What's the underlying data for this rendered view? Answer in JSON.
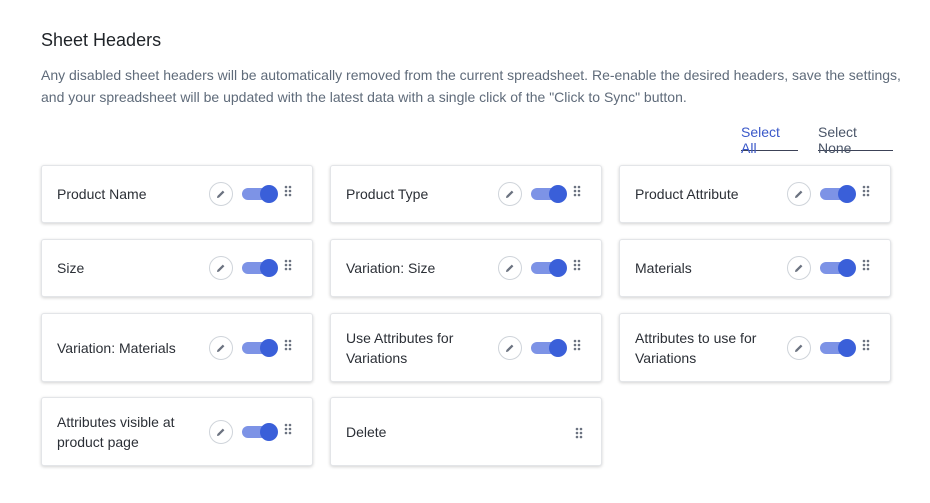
{
  "section": {
    "title": "Sheet Headers",
    "description": "Any disabled sheet headers will be automatically removed from the current spreadsheet. Re-enable the desired headers, save the settings, and your spreadsheet will be updated with the latest data with a single click of the \"Click to Sync\" button."
  },
  "actions": {
    "select_all": "Select All",
    "select_none": "Select None"
  },
  "colors": {
    "accent": "#3a5fd9",
    "toggle_track": "#7d93e6",
    "link": "#3a58c9"
  },
  "headers": [
    {
      "label": "Product Name",
      "enabled": true,
      "editable": true
    },
    {
      "label": "Product Type",
      "enabled": true,
      "editable": true
    },
    {
      "label": "Product Attribute",
      "enabled": true,
      "editable": true
    },
    {
      "label": "Size",
      "enabled": true,
      "editable": true
    },
    {
      "label": "Variation: Size",
      "enabled": true,
      "editable": true
    },
    {
      "label": "Materials",
      "enabled": true,
      "editable": true
    },
    {
      "label": "Variation: Materials",
      "enabled": true,
      "editable": true
    },
    {
      "label": "Use Attributes for Variations",
      "enabled": true,
      "editable": true
    },
    {
      "label": "Attributes to use for Variations",
      "enabled": true,
      "editable": true
    },
    {
      "label": "Attributes visible at product page",
      "enabled": true,
      "editable": true
    },
    {
      "label": "Delete",
      "enabled": null,
      "editable": false
    }
  ],
  "icons": {
    "edit": "pencil-icon",
    "drag": "drag-handle-icon"
  }
}
